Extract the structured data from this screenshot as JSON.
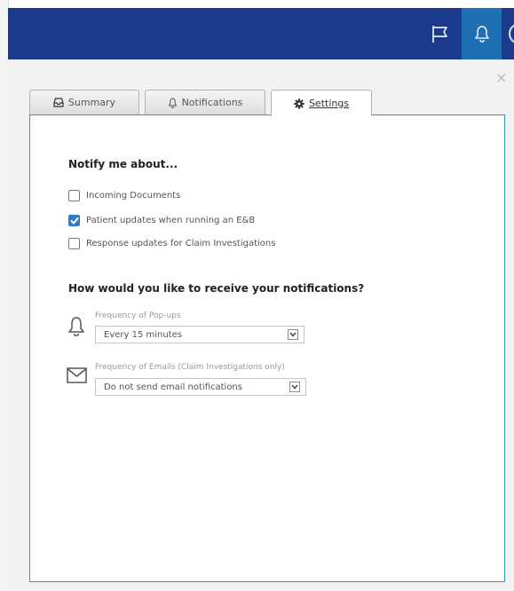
{
  "tabs": [
    {
      "label": "Summary",
      "icon": "inbox-icon"
    },
    {
      "label": "Notifications",
      "icon": "bell-icon"
    },
    {
      "label": "Settings",
      "icon": "gear-icon",
      "active": true
    }
  ],
  "settings": {
    "notify_title": "Notify me about...",
    "options": [
      {
        "label": "Incoming Documents",
        "checked": false
      },
      {
        "label": "Patient updates when running an E&B",
        "checked": true
      },
      {
        "label": "Response updates for Claim Investigations",
        "checked": false
      }
    ],
    "receive_title": "How would you like to receive your notifications?",
    "popups": {
      "label": "Frequency of Pop-ups",
      "value": "Every 15 minutes",
      "icon": "bell-icon"
    },
    "emails": {
      "label": "Frequency of Emails (Claim Investigations only)",
      "value": "Do not send email notifications",
      "icon": "envelope-icon"
    }
  },
  "colors": {
    "header": "#1c3a8c",
    "active_header_button": "#1f6fb4",
    "accent": "#2d7ccb",
    "panel_border": "#3a8fd0"
  }
}
